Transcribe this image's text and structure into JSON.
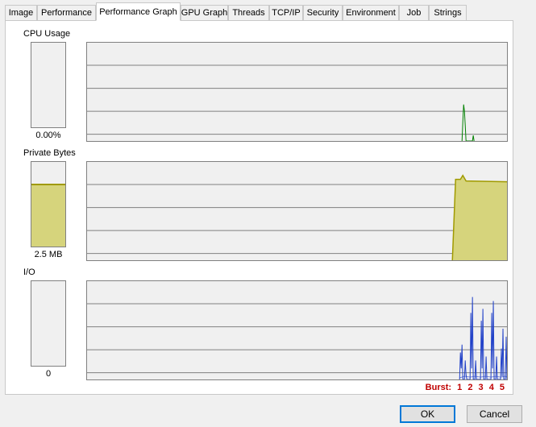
{
  "tabs": [
    {
      "label": "Image",
      "active": false
    },
    {
      "label": "Performance",
      "active": false
    },
    {
      "label": "Performance Graph",
      "active": true
    },
    {
      "label": "GPU Graph",
      "active": false
    },
    {
      "label": "Threads",
      "active": false
    },
    {
      "label": "TCP/IP",
      "active": false
    },
    {
      "label": "Security",
      "active": false
    },
    {
      "label": "Environment",
      "active": false
    },
    {
      "label": "Job",
      "active": false
    },
    {
      "label": "Strings",
      "active": false
    }
  ],
  "sections": {
    "cpu": {
      "label": "CPU Usage",
      "value": "0.00%",
      "level": 0.0
    },
    "private": {
      "label": "Private Bytes",
      "value": "2.5 MB",
      "level": 0.72
    },
    "io": {
      "label": "I/O",
      "value": "0",
      "level": 0.0
    }
  },
  "burst": {
    "label": "Burst:",
    "numbers": [
      "1",
      "2",
      "3",
      "4",
      "5"
    ]
  },
  "buttons": {
    "ok": "OK",
    "cancel": "Cancel"
  },
  "colors": {
    "cpu_line": "#008000",
    "private_fill": "#d6d47c",
    "private_line": "#a09a00",
    "io_line": "#2040c8",
    "burst_text": "#c00000",
    "grid": "#808080"
  }
}
